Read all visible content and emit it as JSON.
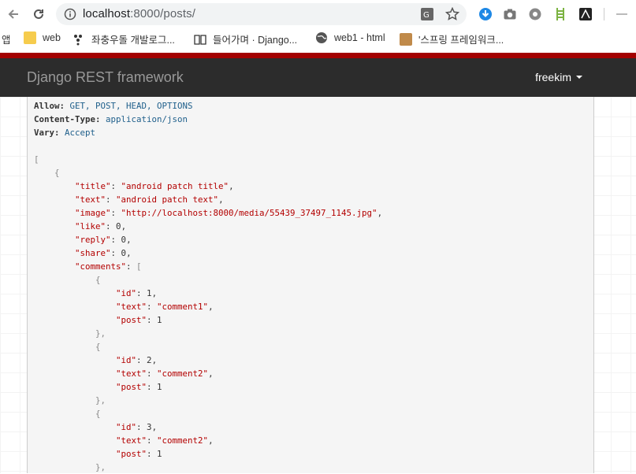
{
  "browser": {
    "url_host": "localhost",
    "url_path": ":8000/posts/",
    "bookmarks": [
      {
        "label": "앱"
      },
      {
        "label": "web"
      },
      {
        "label": "좌충우돌 개발로그..."
      },
      {
        "label": "들어가며 · Django..."
      },
      {
        "label": "web1 - html"
      },
      {
        "label": "'스프링 프레임워크..."
      }
    ]
  },
  "navbar": {
    "brand": "Django REST framework",
    "user": "freekim"
  },
  "headers": {
    "allow_key": "Allow:",
    "allow_val": "GET, POST, HEAD, OPTIONS",
    "ct_key": "Content-Type:",
    "ct_val": "application/json",
    "vary_key": "Vary:",
    "vary_val": "Accept"
  },
  "post": {
    "title": "\"android patch title\"",
    "text": "\"android patch text\"",
    "image": "\"http://localhost:8000/media/55439_37497_1145.jpg\"",
    "like": "0",
    "reply": "0",
    "share": "0"
  },
  "comments": [
    {
      "id": "1",
      "text": "\"comment1\"",
      "post": "1"
    },
    {
      "id": "2",
      "text": "\"comment2\"",
      "post": "1"
    },
    {
      "id": "3",
      "text": "\"comment2\"",
      "post": "1"
    }
  ],
  "colors": {
    "brand_red": "#a30000",
    "navbar": "#2c2c2c"
  }
}
